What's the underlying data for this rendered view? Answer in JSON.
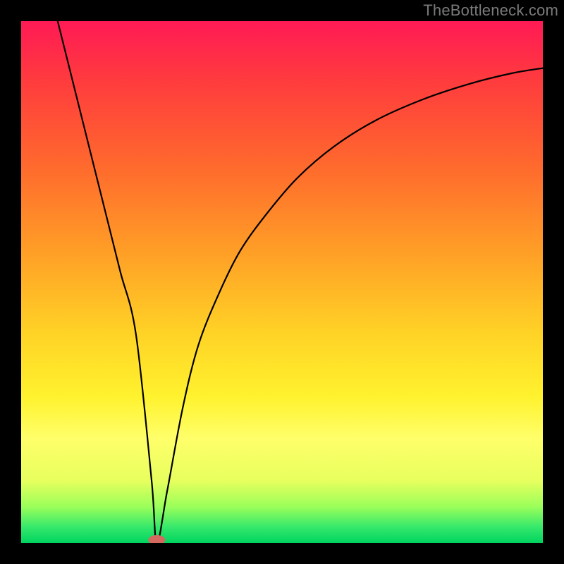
{
  "watermark": "TheBottleneck.com",
  "chart_data": {
    "type": "line",
    "title": "",
    "xlabel": "",
    "ylabel": "",
    "xlim": [
      0,
      100
    ],
    "ylim": [
      0,
      100
    ],
    "curves": [
      {
        "name": "bottleneck-curve",
        "x": [
          7,
          10,
          13,
          16,
          19,
          22,
          25,
          26,
          28,
          31,
          34,
          38,
          42,
          47,
          53,
          60,
          68,
          77,
          86,
          94,
          100
        ],
        "y": [
          100,
          88,
          76,
          64,
          52,
          40,
          12,
          0,
          10,
          26,
          38,
          48,
          56,
          63,
          70,
          76,
          81,
          85,
          88,
          90,
          91
        ]
      }
    ],
    "min_marker": {
      "x": 26,
      "y": 0
    },
    "background_gradient": {
      "top": "#ff1a55",
      "bottom": "#00d460",
      "description": "vertical red→orange→yellow→green"
    }
  }
}
